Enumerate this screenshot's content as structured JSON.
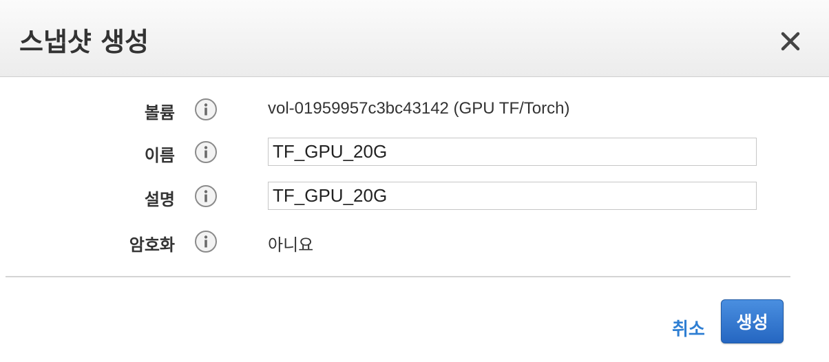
{
  "dialog": {
    "title": "스냅샷 생성"
  },
  "form": {
    "volume": {
      "label": "볼륨",
      "value": "vol-01959957c3bc43142 (GPU TF/Torch)"
    },
    "name": {
      "label": "이름",
      "value": "TF_GPU_20G"
    },
    "description": {
      "label": "설명",
      "value": "TF_GPU_20G"
    },
    "encryption": {
      "label": "암호화",
      "value": "아니요"
    }
  },
  "footer": {
    "cancel_label": "취소",
    "create_label": "생성"
  }
}
